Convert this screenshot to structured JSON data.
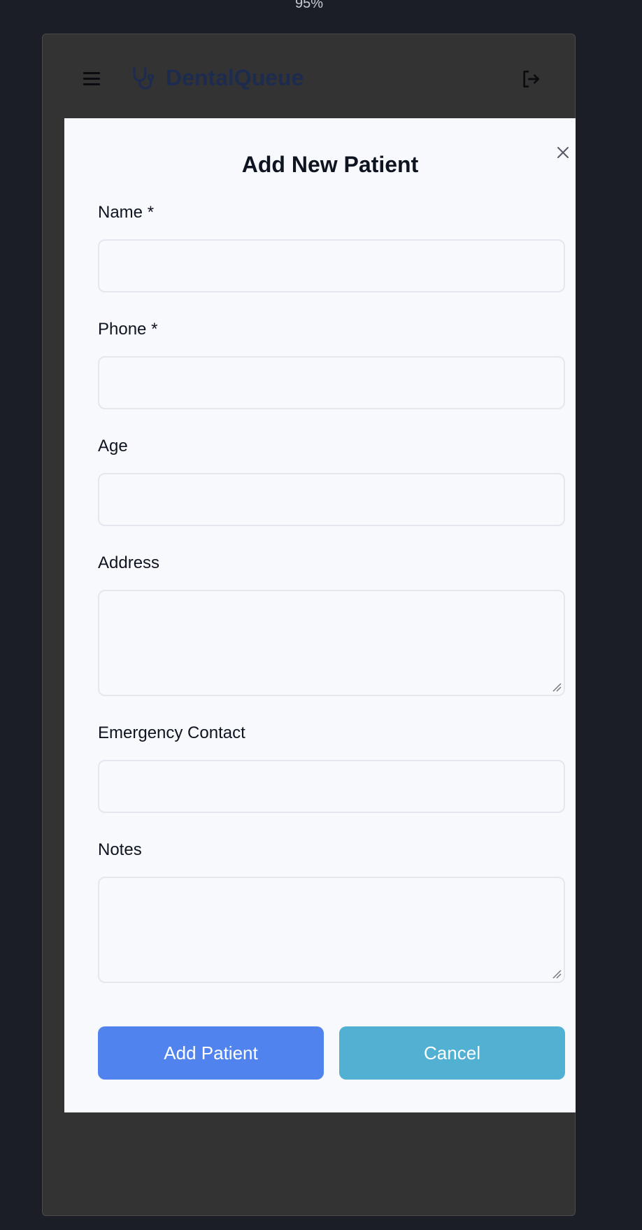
{
  "zoom": {
    "label": "95%"
  },
  "header": {
    "brand_name": "DentalQueue",
    "menu_icon": "hamburger-menu-icon",
    "brand_icon": "stethoscope-icon",
    "logout_icon": "logout-icon"
  },
  "modal": {
    "title": "Add New Patient",
    "close_icon": "close-icon",
    "fields": {
      "name": {
        "label": "Name *",
        "value": "",
        "placeholder": ""
      },
      "phone": {
        "label": "Phone *",
        "value": "",
        "placeholder": ""
      },
      "age": {
        "label": "Age",
        "value": "",
        "placeholder": ""
      },
      "address": {
        "label": "Address",
        "value": "",
        "placeholder": ""
      },
      "emergency_contact": {
        "label": "Emergency Contact",
        "value": "",
        "placeholder": ""
      },
      "notes": {
        "label": "Notes",
        "value": "",
        "placeholder": ""
      }
    },
    "buttons": {
      "submit_label": "Add Patient",
      "cancel_label": "Cancel"
    }
  },
  "colors": {
    "page_background": "#1b1e27",
    "overlay": "#333333",
    "modal_background": "#f8f9fc",
    "brand_text": "#1d2b4f",
    "primary_button": "#5083ee",
    "cancel_button": "#52b1d2"
  }
}
